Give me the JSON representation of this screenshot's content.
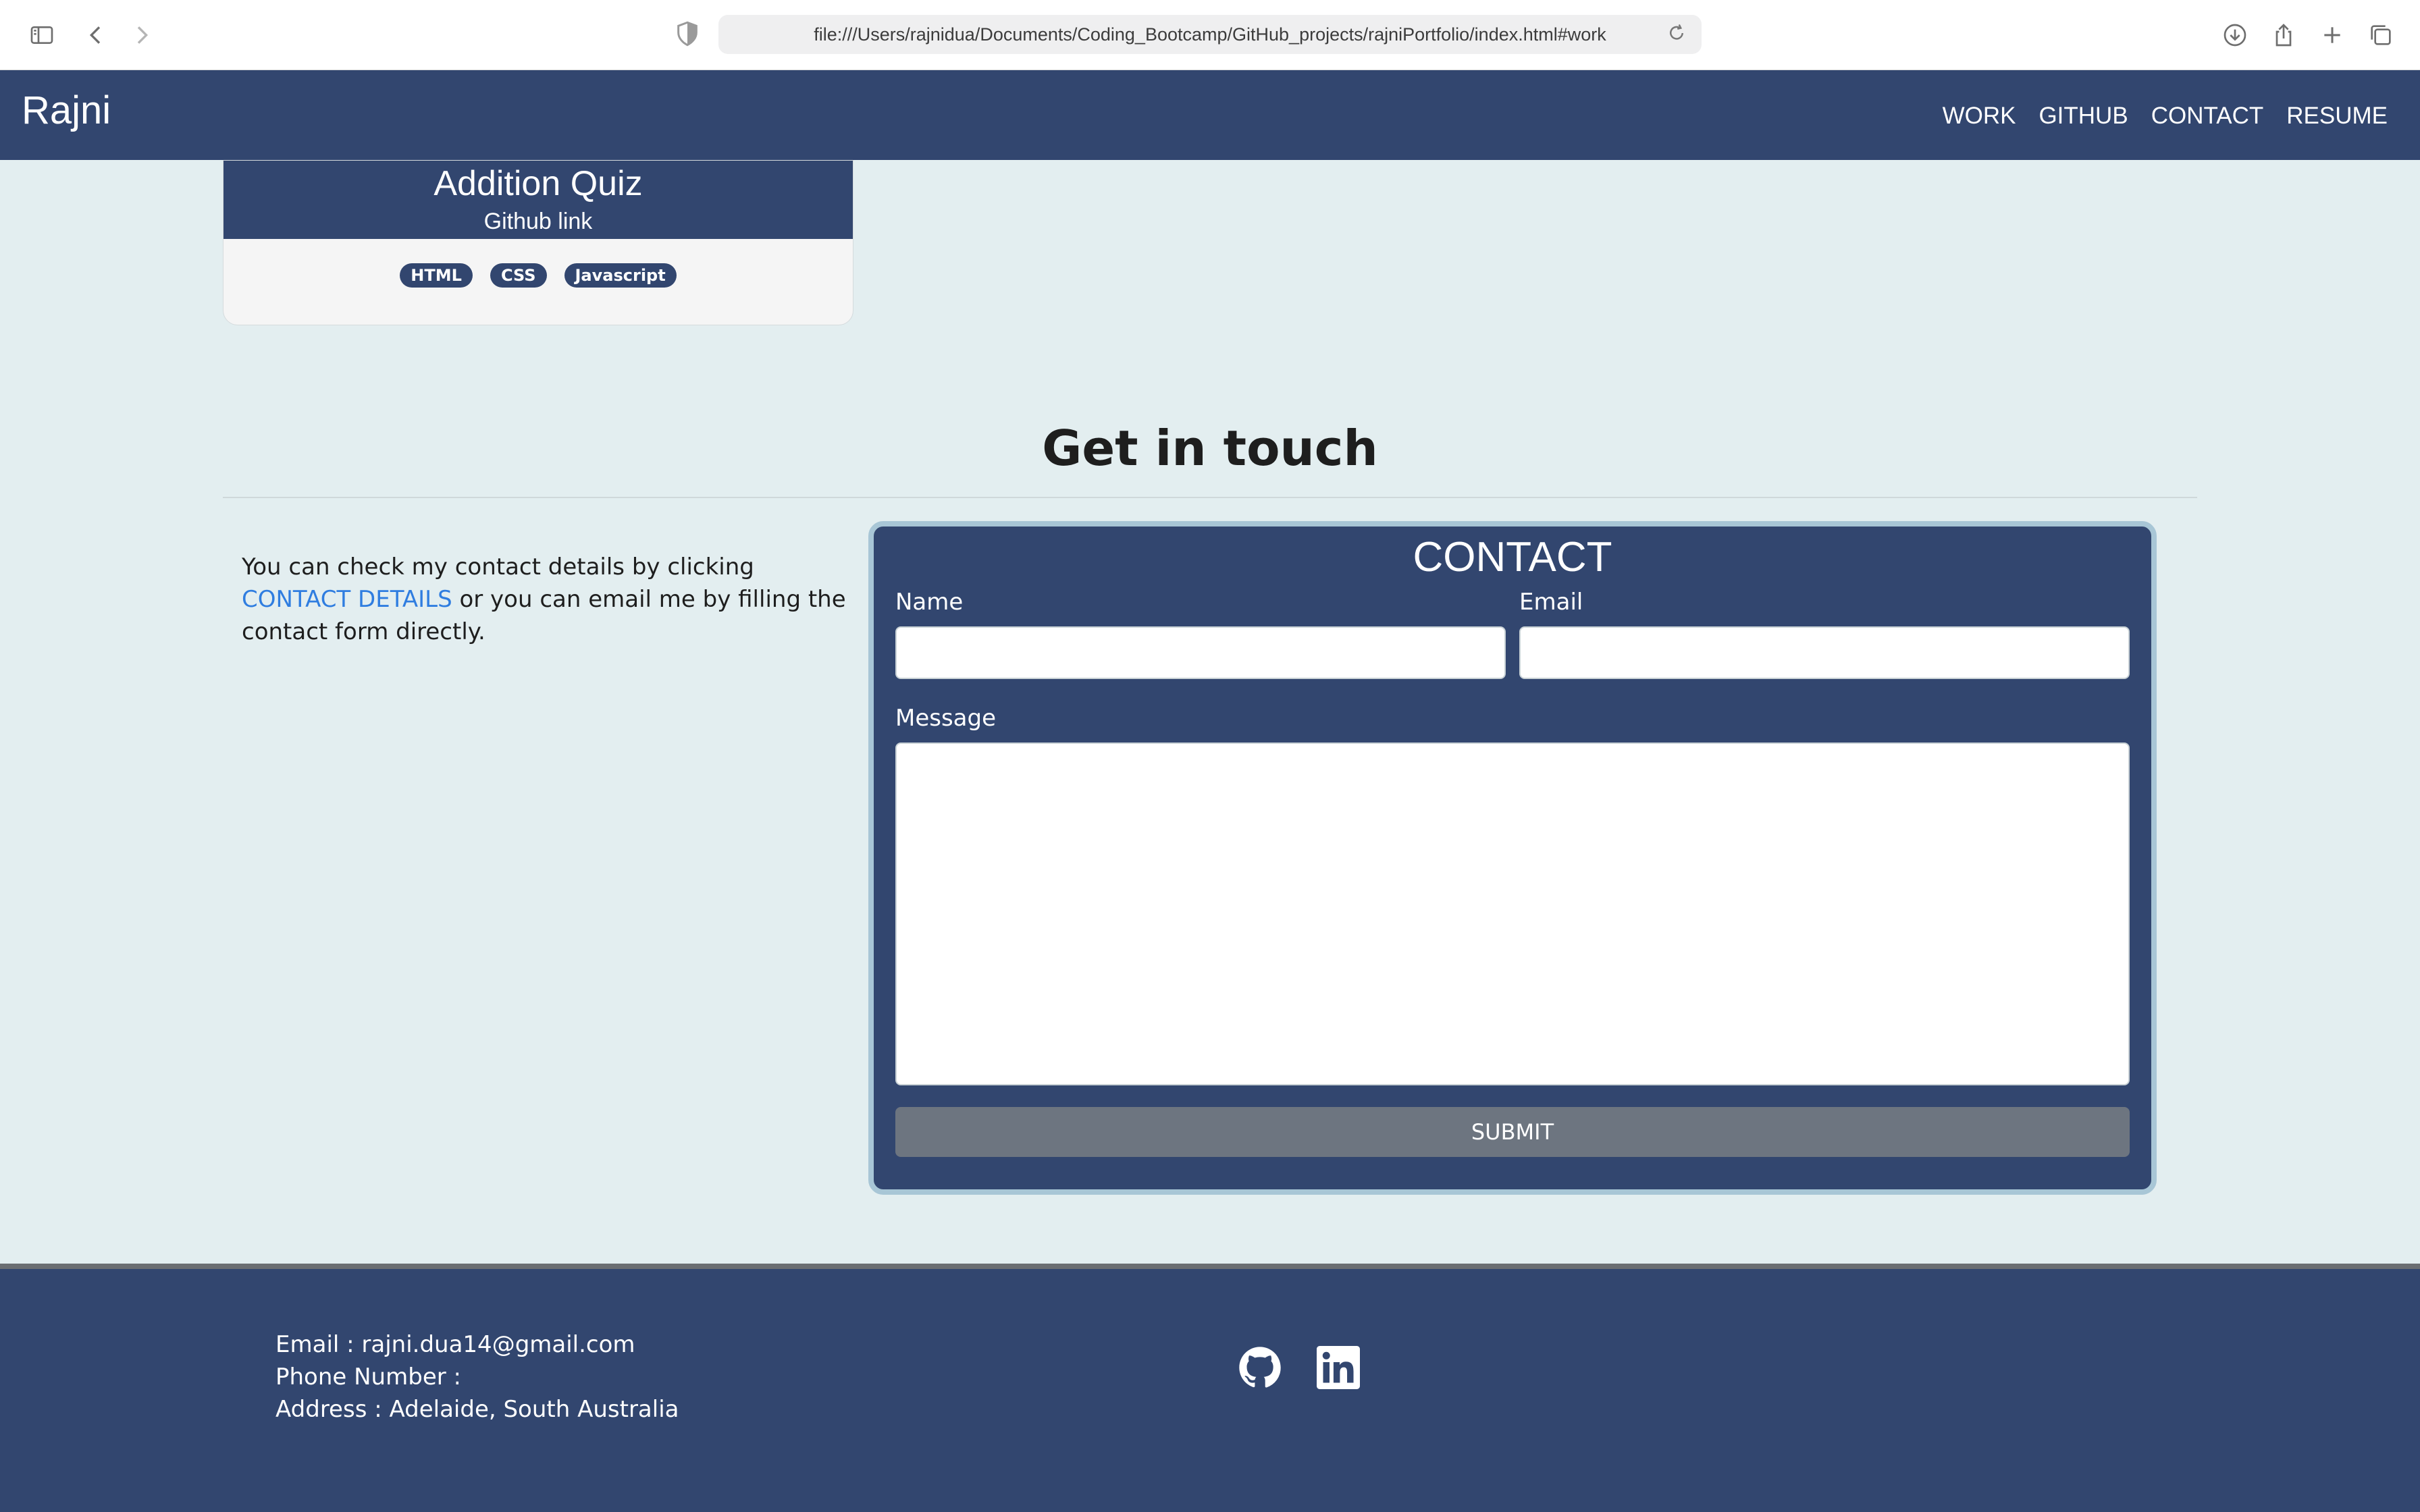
{
  "browser": {
    "url": "file:///Users/rajnidua/Documents/Coding_Bootcamp/GitHub_projects/rajniPortfolio/index.html#work"
  },
  "navbar": {
    "brand": "Rajni",
    "links": [
      "WORK",
      "GITHUB",
      "CONTACT",
      "RESUME"
    ]
  },
  "project": {
    "title": "Addition Quiz",
    "link_text": "Github link",
    "tags": [
      "HTML",
      "CSS",
      "Javascript"
    ]
  },
  "contact_section": {
    "title": "Get in touch",
    "text_before": "You can check my contact details by clicking ",
    "link_text": "CONTACT DETAILS",
    "text_after": " or you can email me by filling the contact form directly."
  },
  "form": {
    "title": "CONTACT",
    "name_label": "Name",
    "email_label": "Email",
    "message_label": "Message",
    "name_value": "",
    "email_value": "",
    "message_value": "",
    "submit_label": "SUBMIT"
  },
  "footer": {
    "email": "Email : rajni.dua14@gmail.com",
    "phone": "Phone Number :",
    "address": "Address : Adelaide, South Australia"
  },
  "colors": {
    "navy": "#32466f",
    "page_bg": "#e3eef0",
    "link_blue": "#2f7de0",
    "submit_gray": "#6d7580"
  },
  "icons": {
    "social": [
      "github-icon",
      "linkedin-icon"
    ],
    "browser": [
      "sidebar-icon",
      "back-icon",
      "forward-icon",
      "shield-icon",
      "reload-icon",
      "download-icon",
      "share-icon",
      "new-tab-icon",
      "tabs-overview-icon"
    ]
  }
}
